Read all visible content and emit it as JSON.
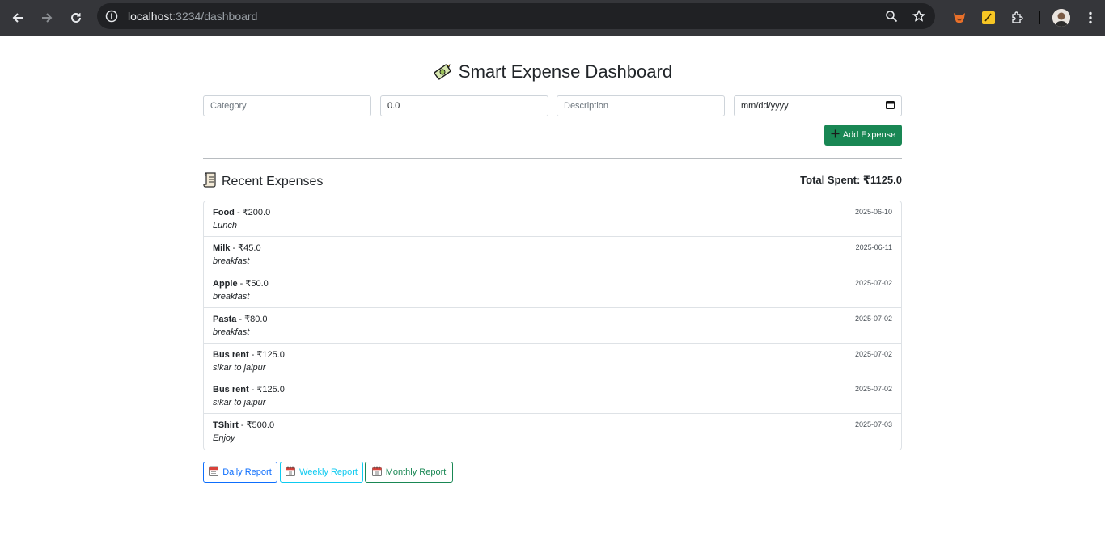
{
  "browser": {
    "url_host": "localhost",
    "url_rest": ":3234/dashboard"
  },
  "page": {
    "title": "Smart Expense Dashboard",
    "title_icon": "money-with-wings-icon"
  },
  "form": {
    "category_placeholder": "Category",
    "amount_value": "0.0",
    "description_placeholder": "Description",
    "date_placeholder": "mm/dd/yyyy",
    "add_button_label": "Add Expense"
  },
  "expenses": {
    "section_title": "Recent Expenses",
    "total_label": "Total Spent: ₹1125.0",
    "items": [
      {
        "category": "Food",
        "amount": " - ₹200.0",
        "description": "Lunch",
        "date": "2025-06-10"
      },
      {
        "category": "Milk",
        "amount": " - ₹45.0",
        "description": "breakfast",
        "date": "2025-06-11"
      },
      {
        "category": "Apple",
        "amount": " - ₹50.0",
        "description": "breakfast",
        "date": "2025-07-02"
      },
      {
        "category": "Pasta",
        "amount": " - ₹80.0",
        "description": "breakfast",
        "date": "2025-07-02"
      },
      {
        "category": "Bus rent",
        "amount": " - ₹125.0",
        "description": "sikar to jaipur",
        "date": "2025-07-02"
      },
      {
        "category": "Bus rent",
        "amount": " - ₹125.0",
        "description": "sikar to jaipur",
        "date": "2025-07-02"
      },
      {
        "category": "TShirt",
        "amount": " - ₹500.0",
        "description": "Enjoy",
        "date": "2025-07-03"
      }
    ]
  },
  "reports": {
    "daily_label": "Daily Report",
    "weekly_label": "Weekly Report",
    "monthly_label": "Monthly Report"
  },
  "colors": {
    "success": "#198754",
    "primary": "#0d6efd",
    "info": "#0dcaf0",
    "chrome_bar": "#35363a",
    "omnibox": "#202124"
  }
}
